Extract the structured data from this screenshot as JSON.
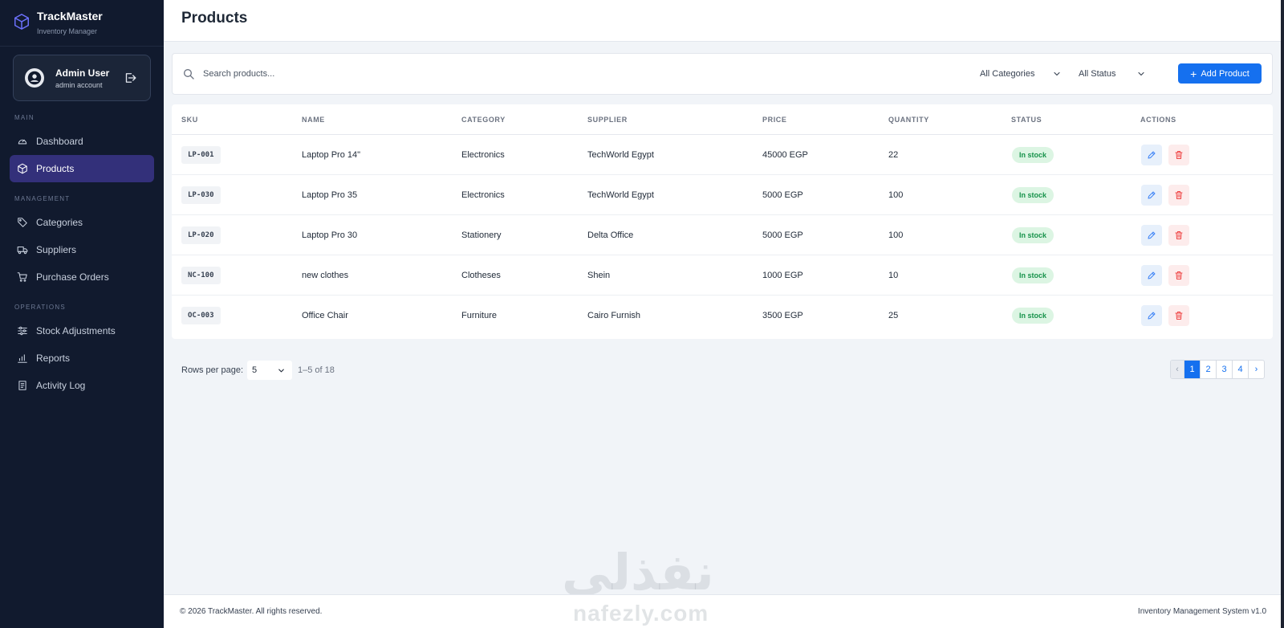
{
  "brand": {
    "title": "TrackMaster",
    "subtitle": "Inventory Manager"
  },
  "user": {
    "name": "Admin User",
    "role": "admin account"
  },
  "nav": {
    "main_label": "MAIN",
    "management_label": "MANAGEMENT",
    "operations_label": "OPERATIONS",
    "items": [
      {
        "label": "Dashboard",
        "icon": "gauge-icon",
        "active": false
      },
      {
        "label": "Products",
        "icon": "box-icon",
        "active": true
      },
      {
        "label": "Categories",
        "icon": "tag-icon",
        "active": false
      },
      {
        "label": "Suppliers",
        "icon": "truck-icon",
        "active": false
      },
      {
        "label": "Purchase Orders",
        "icon": "cart-icon",
        "active": false
      },
      {
        "label": "Stock Adjustments",
        "icon": "sliders-icon",
        "active": false
      },
      {
        "label": "Reports",
        "icon": "bar-chart-icon",
        "active": false
      },
      {
        "label": "Activity Log",
        "icon": "log-icon",
        "active": false
      }
    ]
  },
  "header": {
    "title": "Products"
  },
  "toolbar": {
    "search_placeholder": "Search products...",
    "category_filter": "All Categories",
    "status_filter": "All Status",
    "add_label": "Add Product"
  },
  "table": {
    "columns": [
      "SKU",
      "NAME",
      "CATEGORY",
      "SUPPLIER",
      "PRICE",
      "QUANTITY",
      "STATUS",
      "ACTIONS"
    ],
    "rows": [
      {
        "sku": "LP-001",
        "name": "Laptop Pro 14\"",
        "category": "Electronics",
        "supplier": "TechWorld Egypt",
        "price": "45000 EGP",
        "quantity": "22",
        "status": "In stock"
      },
      {
        "sku": "LP-030",
        "name": "Laptop Pro 35",
        "category": "Electronics",
        "supplier": "TechWorld Egypt",
        "price": "5000 EGP",
        "quantity": "100",
        "status": "In stock"
      },
      {
        "sku": "LP-020",
        "name": "Laptop Pro 30",
        "category": "Stationery",
        "supplier": "Delta Office",
        "price": "5000 EGP",
        "quantity": "100",
        "status": "In stock"
      },
      {
        "sku": "NC-100",
        "name": "new clothes",
        "category": "Clotheses",
        "supplier": "Shein",
        "price": "1000 EGP",
        "quantity": "10",
        "status": "In stock"
      },
      {
        "sku": "OC-003",
        "name": "Office Chair",
        "category": "Furniture",
        "supplier": "Cairo Furnish",
        "price": "3500 EGP",
        "quantity": "25",
        "status": "In stock"
      }
    ]
  },
  "pagination": {
    "rows_label": "Rows per page:",
    "rows_value": "5",
    "range": "1–5 of 18",
    "prev": "‹",
    "next": "›",
    "pages": [
      "1",
      "2",
      "3",
      "4"
    ],
    "current": "1"
  },
  "footer": {
    "copyright": "© 2026 TrackMaster. All rights reserved.",
    "version": "Inventory Management System v1.0"
  },
  "watermark": {
    "arabic": "نفذلي",
    "latin": "nafezly.com"
  },
  "colors": {
    "accent": "#1570ef",
    "sidebar": "#111a2e",
    "active_nav": "#33307a",
    "in_stock_bg": "#dcf5e3",
    "in_stock_text": "#16924a"
  }
}
